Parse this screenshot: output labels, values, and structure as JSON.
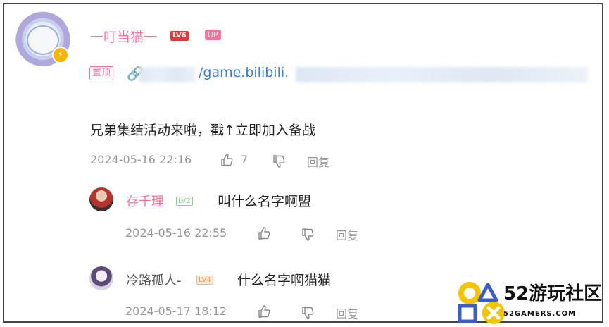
{
  "comment": {
    "username": "一叮当猫一",
    "level": "LV6",
    "up_badge": "UP",
    "pinned_label": "置顶",
    "link_text": "/game.bilibili.",
    "body": "兄弟集结活动来啦，戳↑立即加入备战",
    "timestamp": "2024-05-16 22:16",
    "like_count": "7",
    "reply_label": "回复"
  },
  "replies": [
    {
      "username": "存千理",
      "level": "LV2",
      "body": "叫什么名字啊盟",
      "timestamp": "2024-05-16 22:55",
      "reply_label": "回复"
    },
    {
      "username": "冷路孤人-",
      "level": "LV4",
      "body": "什么名字啊猫猫",
      "timestamp": "2024-05-17 18:12",
      "reply_label": "回复"
    }
  ],
  "watermark": {
    "title": "52游玩社区",
    "site": "52GAMERS.COM"
  },
  "colors": {
    "accent": "#fb7299",
    "link": "#3a7fd9",
    "meta": "#999999"
  }
}
